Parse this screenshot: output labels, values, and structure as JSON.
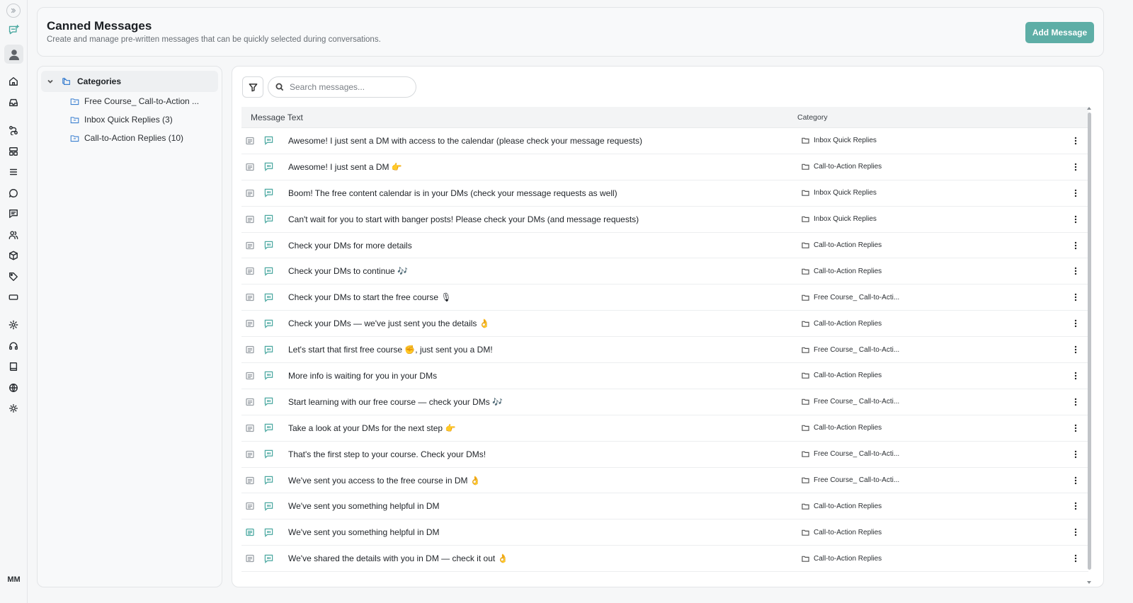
{
  "rail": {
    "icons": [
      "collapse-icon",
      "brand-chat-icon",
      "user-avatar-icon",
      "home-icon",
      "inbox-icon",
      "workflow-icon",
      "layout-icon",
      "list-icon",
      "chat-icon",
      "message-square-icon",
      "users-icon",
      "box-icon",
      "tag-icon",
      "ticket-icon",
      "settings-icon",
      "headset-icon",
      "book-icon",
      "globe-icon",
      "sun-icon"
    ],
    "initials": "MM"
  },
  "header": {
    "title": "Canned Messages",
    "subtitle": "Create and manage pre-written messages that can be quickly selected during conversations.",
    "add_button": "Add Message"
  },
  "sidebar": {
    "root_label": "Categories",
    "items": [
      {
        "label": "Free Course_ Call-to-Action ..."
      },
      {
        "label": "Inbox Quick Replies (3)"
      },
      {
        "label": "Call-to-Action Replies (10)"
      }
    ]
  },
  "search": {
    "placeholder": "Search messages..."
  },
  "table": {
    "headers": {
      "message": "Message Text",
      "category": "Category"
    },
    "rows": [
      {
        "text": "Awesome! I just sent a DM with access to the calendar (please check your message requests)",
        "category": "Inbox Quick Replies",
        "active": false
      },
      {
        "text": "Awesome! I just sent a DM 👉",
        "category": "Call-to-Action Replies",
        "active": false
      },
      {
        "text": "Boom! The free content calendar is in your DMs (check your message requests as well)",
        "category": "Inbox Quick Replies",
        "active": false
      },
      {
        "text": "Can't wait for you to start with banger posts! Please check your DMs (and message requests)",
        "category": "Inbox Quick Replies",
        "active": false
      },
      {
        "text": "Check your DMs for more details",
        "category": "Call-to-Action Replies",
        "active": false
      },
      {
        "text": "Check your DMs to continue 🎶",
        "category": "Call-to-Action Replies",
        "active": false
      },
      {
        "text": "Check your DMs to start the free course 🎙",
        "category": "Free Course_ Call-to-Acti...",
        "active": false
      },
      {
        "text": "Check your DMs — we've just sent you the details 👌",
        "category": "Call-to-Action Replies",
        "active": false
      },
      {
        "text": "Let's start that first free course ✊, just sent you a DM!",
        "category": "Free Course_ Call-to-Acti...",
        "active": false
      },
      {
        "text": "More info is waiting for you in your DMs",
        "category": "Call-to-Action Replies",
        "active": false
      },
      {
        "text": "Start learning with our free course — check your DMs 🎶",
        "category": "Free Course_ Call-to-Acti...",
        "active": false
      },
      {
        "text": "Take a look at your DMs for the next step 👉",
        "category": "Call-to-Action Replies",
        "active": false
      },
      {
        "text": "That's the first step to your course. Check your DMs!",
        "category": "Free Course_ Call-to-Acti...",
        "active": false
      },
      {
        "text": "We've sent you access to the free course in DM 👌",
        "category": "Free Course_ Call-to-Acti...",
        "active": false
      },
      {
        "text": "We've sent you something helpful in DM",
        "category": "Call-to-Action Replies",
        "active": false
      },
      {
        "text": "We've sent you something helpful in DM",
        "category": "Call-to-Action Replies",
        "active": true
      },
      {
        "text": "We've shared the details with you in DM — check it out 👌",
        "category": "Call-to-Action Replies",
        "active": false
      }
    ]
  },
  "colors": {
    "accent": "#5eaea6",
    "folder_blue": "#3a7fd0"
  }
}
